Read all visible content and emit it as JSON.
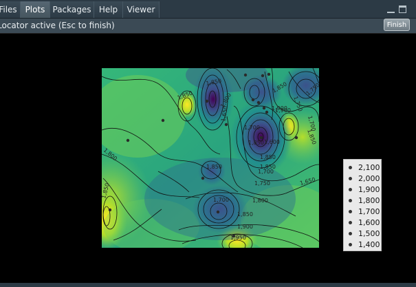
{
  "tabs": [
    {
      "label": "Files",
      "active": false
    },
    {
      "label": "Plots",
      "active": true
    },
    {
      "label": "Packages",
      "active": false
    },
    {
      "label": "Help",
      "active": false
    },
    {
      "label": "Viewer",
      "active": false
    }
  ],
  "locator": {
    "message": "Locator active (Esc to finish)",
    "finish_label": "Finish"
  },
  "plot": {
    "contour_labels": [
      "1,850",
      "1,850",
      "1,800",
      "1,900",
      "1,850",
      "1,750",
      "1,700",
      "1,850",
      "1,850",
      "1,800",
      "1,900",
      "1,850",
      "1,750",
      "1,850",
      "1,800",
      "1,850",
      "1,900",
      "1,950",
      "1,850",
      "1,650",
      "1,700",
      "1,750",
      "1,700",
      "1,850",
      "1,650",
      "1,600",
      "1,700"
    ],
    "legend_labels": [
      "2,100",
      "2,000",
      "1,900",
      "1,800",
      "1,700",
      "1,600",
      "1,500",
      "1,400"
    ]
  },
  "colors": {
    "tabbar": "#2c3a45",
    "active_tab": "#566773",
    "plot_low": "#440154",
    "plot_mid": "#21908d",
    "plot_high": "#fde725"
  }
}
